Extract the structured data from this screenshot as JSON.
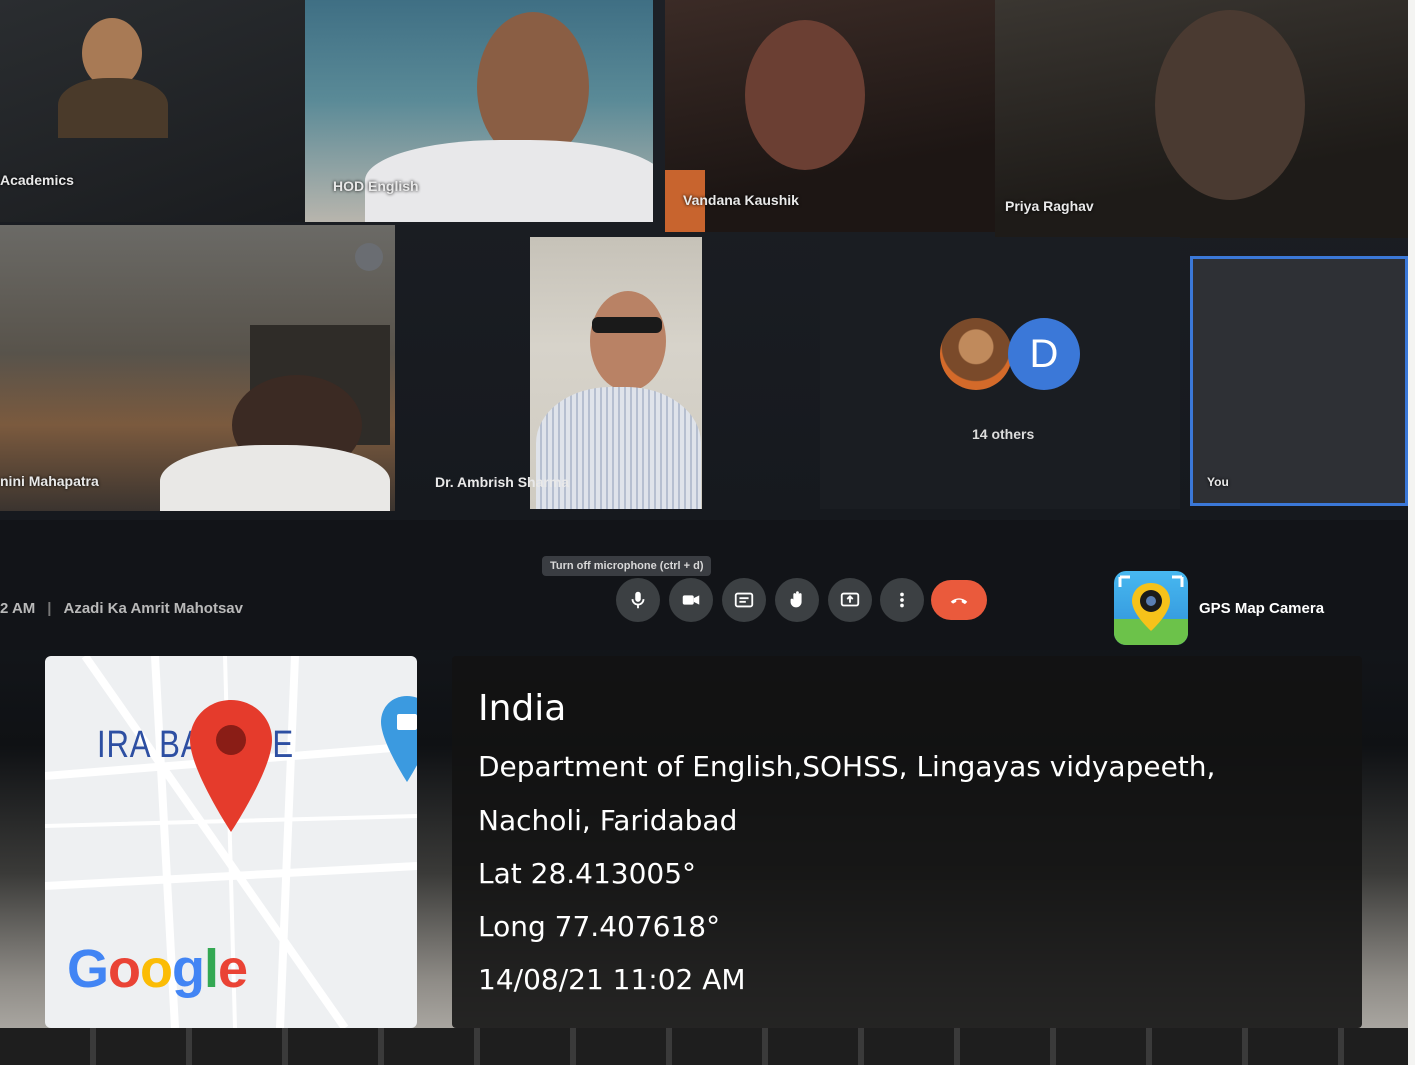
{
  "meeting": {
    "time_fragment": "2 AM",
    "separator": "|",
    "title": "Azadi Ka Amrit Mahotsav",
    "tooltip": "Turn off microphone (ctrl + d)",
    "others_label": "14 others",
    "avatar_letter": "D"
  },
  "participants": [
    {
      "name": "Academics"
    },
    {
      "name": "HOD English"
    },
    {
      "name": "Vandana Kaushik"
    },
    {
      "name": "Priya Raghav"
    },
    {
      "name": "nini Mahapatra"
    },
    {
      "name": "Dr. Ambrish Sharma"
    },
    {
      "name": "You"
    }
  ],
  "controls": [
    {
      "icon": "mic-icon"
    },
    {
      "icon": "camera-icon"
    },
    {
      "icon": "captions-icon"
    },
    {
      "icon": "raise-hand-icon"
    },
    {
      "icon": "present-icon"
    },
    {
      "icon": "more-vert-icon"
    },
    {
      "icon": "end-call-icon"
    }
  ],
  "gps_app": {
    "name": "GPS Map Camera"
  },
  "map": {
    "place_text": "IRA BARAGE",
    "google": "Google"
  },
  "location": {
    "country": "India",
    "address_line1": "Department of English,SOHSS, Lingayas vidyapeeth,",
    "address_line2": "Nacholi, Faridabad",
    "lat": "Lat 28.413005°",
    "long": "Long 77.407618°",
    "datetime": "14/08/21 11:02 AM"
  },
  "colors": {
    "accent": "#3b78d8",
    "end_call": "#ea5a3c",
    "pin": "#e53b2c"
  }
}
